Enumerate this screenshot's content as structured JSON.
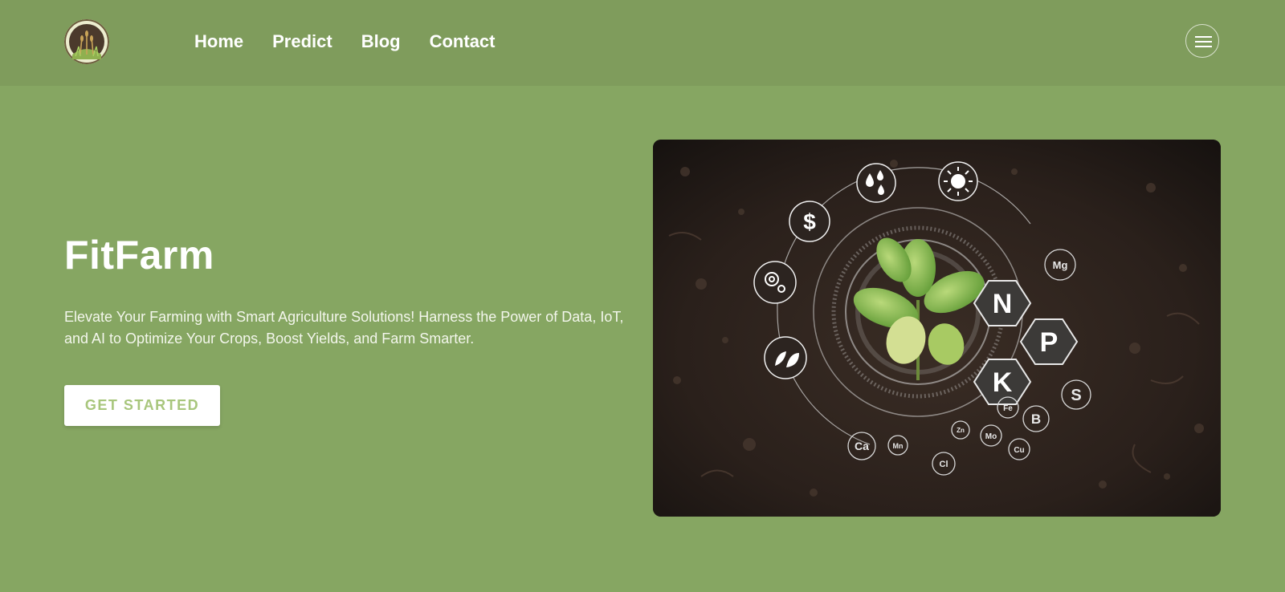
{
  "nav": {
    "links": [
      "Home",
      "Predict",
      "Blog",
      "Contact"
    ]
  },
  "hero": {
    "title": "FitFarm",
    "description": "Elevate Your Farming with Smart Agriculture Solutions! Harness the Power of Data, IoT, and AI to Optimize Your Crops, Boost Yields, and Farm Smarter.",
    "cta_label": "GET STARTED"
  },
  "image_overlay": {
    "hex_labels": [
      "N",
      "P",
      "K"
    ],
    "nutrient_labels": [
      "Mg",
      "S",
      "B",
      "Fe",
      "Mo",
      "Cu",
      "Zn",
      "Ca",
      "Mn",
      "Cl"
    ],
    "dollar_symbol": "$"
  },
  "colors": {
    "page_background": "#86a662",
    "navbar_background": "#7f9c5c",
    "cta_text": "#a8c67c",
    "text_primary": "#ffffff"
  },
  "icons": [
    "logo-icon",
    "hamburger-menu-icon",
    "water-drops-icon",
    "sun-icon",
    "dollar-icon",
    "gear-icon",
    "leaf-icon",
    "seedling-icon"
  ]
}
